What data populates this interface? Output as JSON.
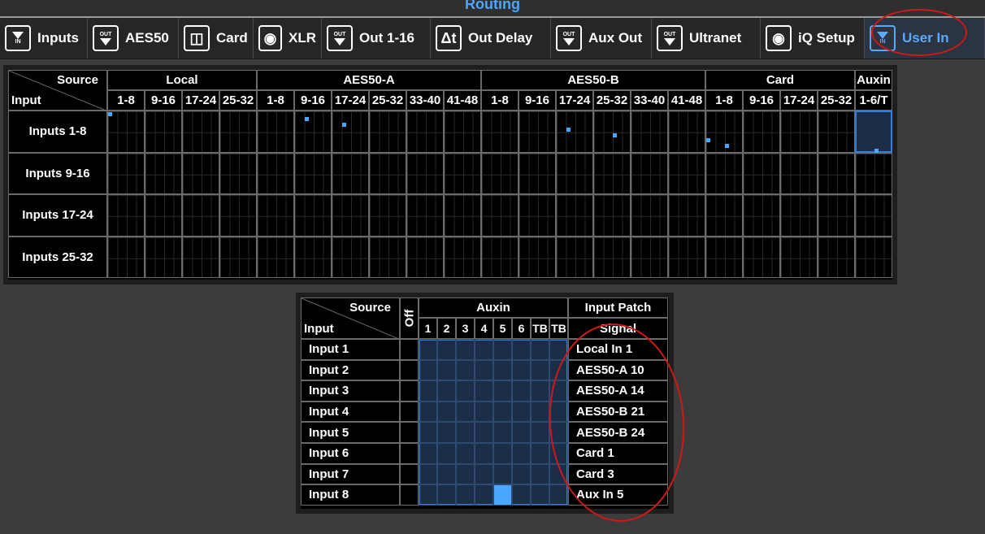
{
  "window": {
    "title": "Routing"
  },
  "tabs": [
    {
      "label": "Inputs",
      "icon": "input-in-icon",
      "active": false
    },
    {
      "label": "AES50",
      "icon": "output-out-icon",
      "active": false
    },
    {
      "label": "Card",
      "icon": "card-icon",
      "active": false
    },
    {
      "label": "XLR",
      "icon": "xlr-connector-icon",
      "active": false
    },
    {
      "label": "Out 1-16",
      "icon": "output-out-icon",
      "active": false
    },
    {
      "label": "Out Delay",
      "icon": "delay-icon",
      "active": false
    },
    {
      "label": "Aux Out",
      "icon": "output-out-icon",
      "active": false
    },
    {
      "label": "Ultranet",
      "icon": "output-out-icon",
      "active": false
    },
    {
      "label": "iQ Setup",
      "icon": "speaker-icon",
      "active": false
    },
    {
      "label": "User In",
      "icon": "input-in-icon",
      "active": true
    }
  ],
  "tab_icon_text": {
    "in": "IN",
    "out": "OUT"
  },
  "matrix": {
    "corner_source": "Source",
    "corner_input": "Input",
    "groups": [
      {
        "label": "Local",
        "cols": [
          "1-8",
          "9-16",
          "17-24",
          "25-32"
        ]
      },
      {
        "label": "AES50-A",
        "cols": [
          "1-8",
          "9-16",
          "17-24",
          "25-32",
          "33-40",
          "41-48"
        ]
      },
      {
        "label": "AES50-B",
        "cols": [
          "1-8",
          "9-16",
          "17-24",
          "25-32",
          "33-40",
          "41-48"
        ]
      },
      {
        "label": "Card",
        "cols": [
          "1-8",
          "9-16",
          "17-24",
          "25-32"
        ]
      },
      {
        "label": "Auxin",
        "cols": [
          "1-6/T"
        ]
      }
    ],
    "rows": [
      "Inputs 1-8",
      "Inputs 9-16",
      "Inputs 17-24",
      "Inputs 25-32"
    ]
  },
  "patch": {
    "corner_source": "Source",
    "corner_input": "Input",
    "off_label": "Off",
    "aux_label": "Auxin",
    "aux_cols": [
      "1",
      "2",
      "3",
      "4",
      "5",
      "6",
      "TB",
      "TB"
    ],
    "input_patch_label": "Input Patch",
    "signal_label": "Signal",
    "rows": [
      {
        "input": "Input 1",
        "signal": "Local In 1"
      },
      {
        "input": "Input 2",
        "signal": "AES50-A 10"
      },
      {
        "input": "Input 3",
        "signal": "AES50-A 14"
      },
      {
        "input": "Input 4",
        "signal": "AES50-B 21"
      },
      {
        "input": "Input 5",
        "signal": "AES50-B 24"
      },
      {
        "input": "Input 6",
        "signal": "Card 1"
      },
      {
        "input": "Input 7",
        "signal": "Card 3"
      },
      {
        "input": "Input 8",
        "signal": "Aux In 5"
      }
    ],
    "selected": {
      "input": "Input 8",
      "aux": "5"
    }
  },
  "colors": {
    "accent": "#4aa6ff",
    "annotation": "#d01818",
    "highlight": "#1c2d48"
  }
}
